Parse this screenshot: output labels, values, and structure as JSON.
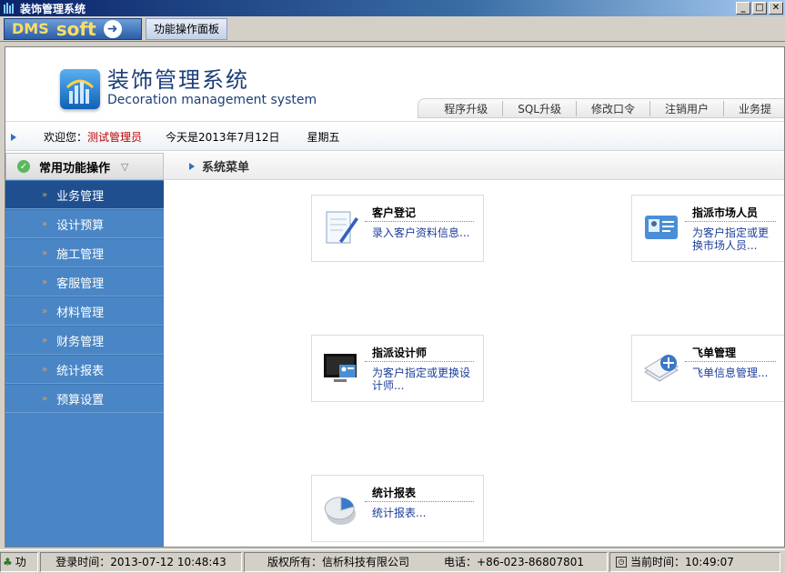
{
  "window": {
    "title": "装饰管理系统"
  },
  "toolbar": {
    "logo_dms": "DMS",
    "logo_soft": "soft",
    "panel_tab": "功能操作面板"
  },
  "header": {
    "title": "装饰管理系统",
    "subtitle": "Decoration management system",
    "nav": [
      "程序升级",
      "SQL升级",
      "修改口令",
      "注销用户",
      "业务提"
    ]
  },
  "infobar": {
    "welcome_label": "欢迎您：",
    "user": "测试管理员",
    "date": "今天是2013年7月12日",
    "weekday": "星期五"
  },
  "sidebar": {
    "header": "常用功能操作",
    "items": [
      {
        "label": "业务管理",
        "active": true
      },
      {
        "label": "设计预算"
      },
      {
        "label": "施工管理"
      },
      {
        "label": "客服管理"
      },
      {
        "label": "材料管理"
      },
      {
        "label": "财务管理"
      },
      {
        "label": "统计报表"
      },
      {
        "label": "预算设置"
      }
    ]
  },
  "content": {
    "title": "系统菜单",
    "cards": [
      {
        "title": "客户登记",
        "desc": "录入客户资料信息...",
        "icon": "document-pen-icon"
      },
      {
        "title": "指派市场人员",
        "desc": "为客户指定或更换市场人员...",
        "icon": "contact-card-icon"
      },
      {
        "title": "指派设计师",
        "desc": "为客户指定或更换设计师...",
        "icon": "monitor-contact-icon"
      },
      {
        "title": "飞单管理",
        "desc": "飞单信息管理...",
        "icon": "document-add-icon"
      },
      {
        "title": "统计报表",
        "desc": "统计报表...",
        "icon": "pie-chart-icon"
      }
    ]
  },
  "statusbar": {
    "fn": "功",
    "login": "登录时间：2013-07-12 10:48:43",
    "copyright": "版权所有：信析科技有限公司",
    "phone": "电话：+86-023-86807801",
    "current": "当前时间：10:49:07"
  }
}
